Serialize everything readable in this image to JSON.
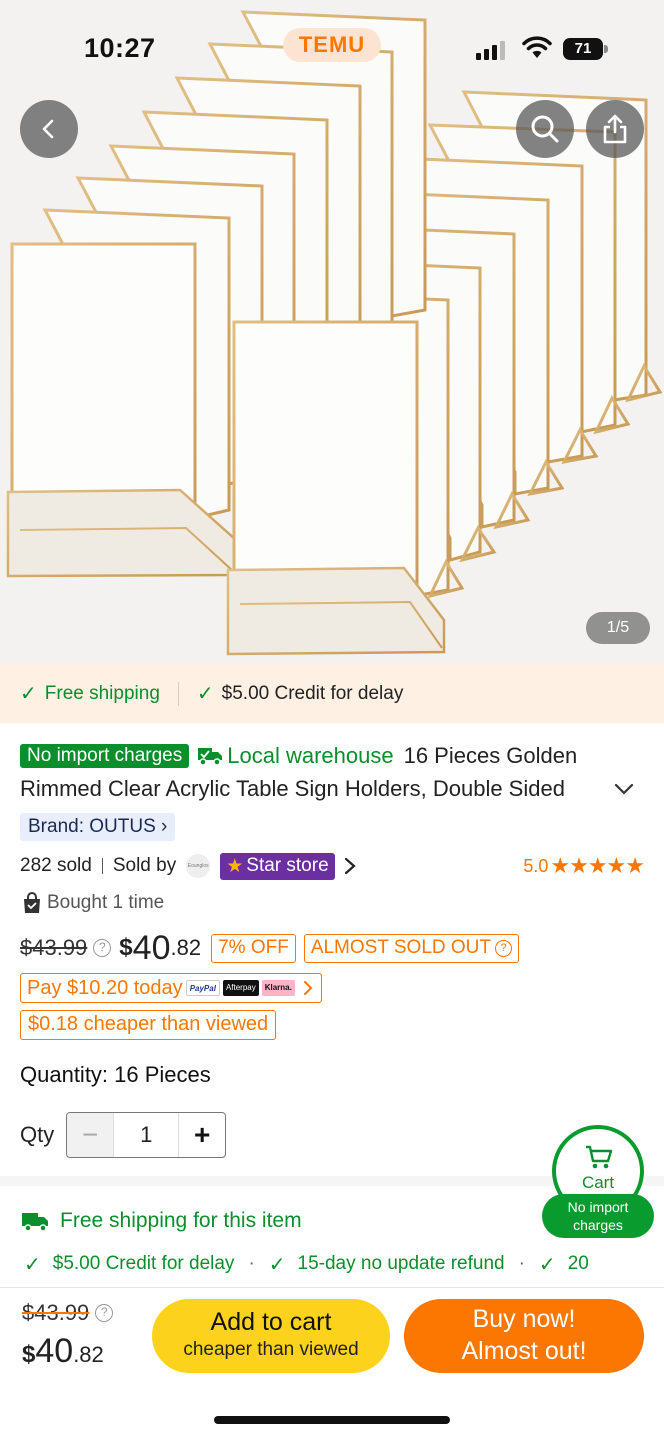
{
  "status_bar": {
    "time": "10:27",
    "battery": "71",
    "app_logo": "TEMU"
  },
  "hero": {
    "pager": "1/5"
  },
  "icons": {
    "back": "chevron-left-icon",
    "search": "search-icon",
    "share": "share-icon"
  },
  "promo_strip": {
    "free_shipping": "Free shipping",
    "credit": "$5.00 Credit for delay"
  },
  "product": {
    "badge": "No import charges",
    "local_warehouse": "Local warehouse",
    "title_line1": "16 Pieces Golden",
    "title_line2": "Rimmed Clear Acrylic Table Sign Holders, Double Sided",
    "brand": "Brand: OUTUS",
    "sold": "282 sold",
    "sold_by": "Sold by",
    "store_logo_text": "Eounglos",
    "store": "Star store",
    "rating": "5.0",
    "rating_stars": 5,
    "bought": "Bought 1 time"
  },
  "price": {
    "old": "$43.99",
    "currency": "$",
    "integer": "40",
    "decimal": ".82",
    "discount": "7% OFF",
    "almost_sold_out": "ALMOST SOLD OUT",
    "pay_today": "Pay $10.20 today",
    "pay_paypal": "PayPal",
    "pay_afterpay": "Afterpay",
    "pay_klarna": "Klarna.",
    "cheaper": "$0.18 cheaper than viewed"
  },
  "quantity": {
    "label": "Quantity: 16 Pieces",
    "qty_label": "Qty",
    "value": "1"
  },
  "cart_float": {
    "label": "Cart",
    "no_import": "No import",
    "charges": "charges"
  },
  "shipping": {
    "free_item": "Free shipping for this item",
    "credit": "$5.00 Credit for delay",
    "refund": "15-day no update refund",
    "more": "20"
  },
  "bottom_bar": {
    "old_price": "$43.99",
    "currency": "$",
    "integer": "40",
    "decimal": ".82",
    "add_to_cart": "Add to cart",
    "add_sub": "cheaper than viewed",
    "buy_line1": "Buy now!",
    "buy_line2": "Almost out!"
  },
  "colors": {
    "accent": "#fb7701",
    "green": "#0a8f2c",
    "yellow": "#fcd21d",
    "purple": "#6b2fa1"
  }
}
